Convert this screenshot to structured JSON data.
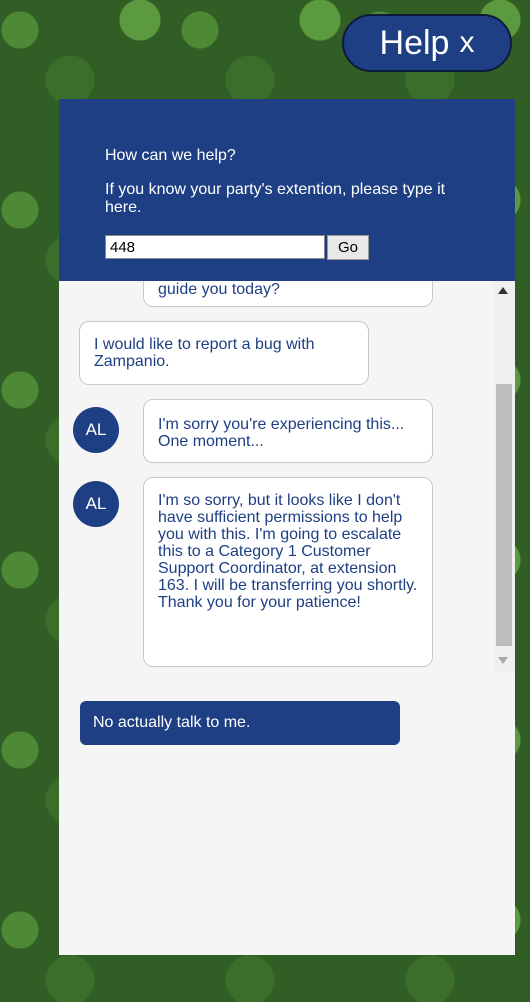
{
  "help_tab": {
    "label": "Help",
    "close_label": "x"
  },
  "header": {
    "title": "How can we help?",
    "instruction": "If you know your party's extention, please type it here.",
    "extension_value": "448",
    "go_label": "Go"
  },
  "messages": [
    {
      "sender": "agent",
      "avatar": "",
      "text": "guide you today?"
    },
    {
      "sender": "user",
      "avatar": "",
      "text": "I would like to report a bug with Zampanio."
    },
    {
      "sender": "agent",
      "avatar": "AL",
      "text": "I'm sorry you're experiencing this... One moment..."
    },
    {
      "sender": "agent",
      "avatar": "AL",
      "text": "I'm so sorry, but it looks like I don't have sufficient permissions to help you with this. I'm going to escalate this to a Category 1 Customer Support Coordinator, at extension 163. I will be transferring you shortly. Thank you for your patience!"
    }
  ],
  "reply_option": "No actually talk to me.",
  "colors": {
    "brand": "#1e3f83",
    "panel_bg": "#f5f5f5"
  }
}
